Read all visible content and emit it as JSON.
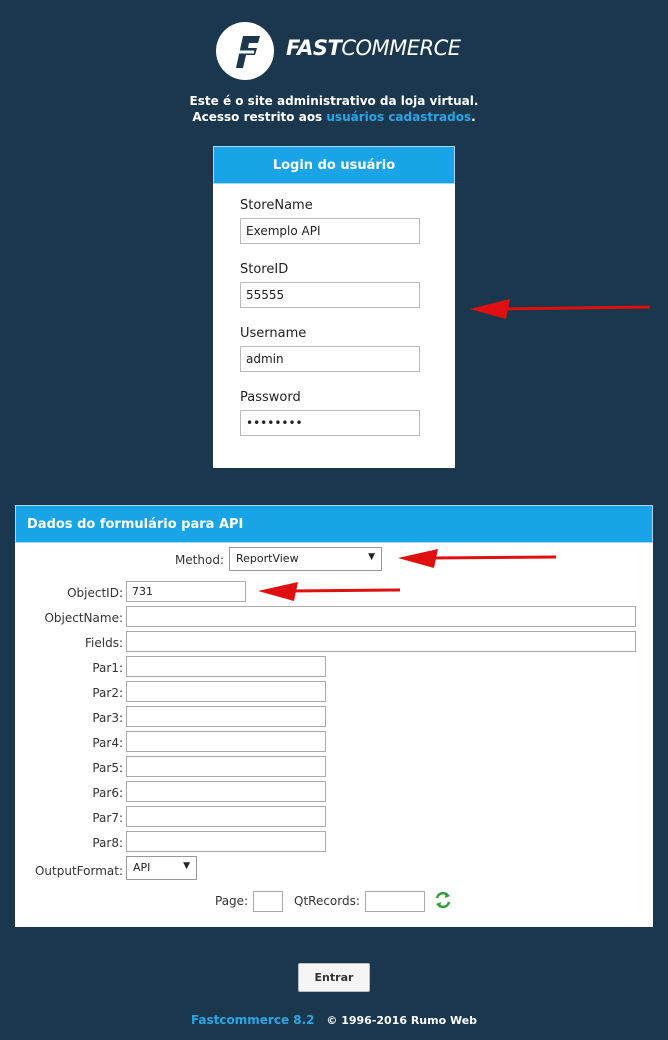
{
  "brand": {
    "bold": "FAST",
    "light": "COMMERCE"
  },
  "intro": {
    "line1": "Este é o site administrativo da loja virtual.",
    "line2_prefix": "Acesso restrito aos ",
    "line2_link": "usuários cadastrados",
    "line2_suffix": "."
  },
  "login": {
    "title": "Login do usuário",
    "storename_label": "StoreName",
    "storename_value": "Exemplo API",
    "storeid_label": "StoreID",
    "storeid_value": "55555",
    "username_label": "Username",
    "username_value": "admin",
    "password_label": "Password",
    "password_value": "••••••••"
  },
  "api": {
    "title": "Dados do formulário para API",
    "method_label": "Method:",
    "method_value": "ReportView",
    "objectid_label": "ObjectID:",
    "objectid_value": "731",
    "objectname_label": "ObjectName:",
    "fields_label": "Fields:",
    "par1_label": "Par1:",
    "par2_label": "Par2:",
    "par3_label": "Par3:",
    "par4_label": "Par4:",
    "par5_label": "Par5:",
    "par6_label": "Par6:",
    "par7_label": "Par7:",
    "par8_label": "Par8:",
    "outputformat_label": "OutputFormat:",
    "outputformat_value": "API",
    "page_label": "Page:",
    "qtrecords_label": "QtRecords:"
  },
  "actions": {
    "submit_label": "Entrar"
  },
  "footer": {
    "version": "Fastcommerce 8.2",
    "copyright": "© 1996-2016  Rumo Web"
  },
  "colors": {
    "background": "#1a374d",
    "accent": "#18a4e6",
    "link": "#2aa6e8",
    "arrow": "#e01010"
  }
}
